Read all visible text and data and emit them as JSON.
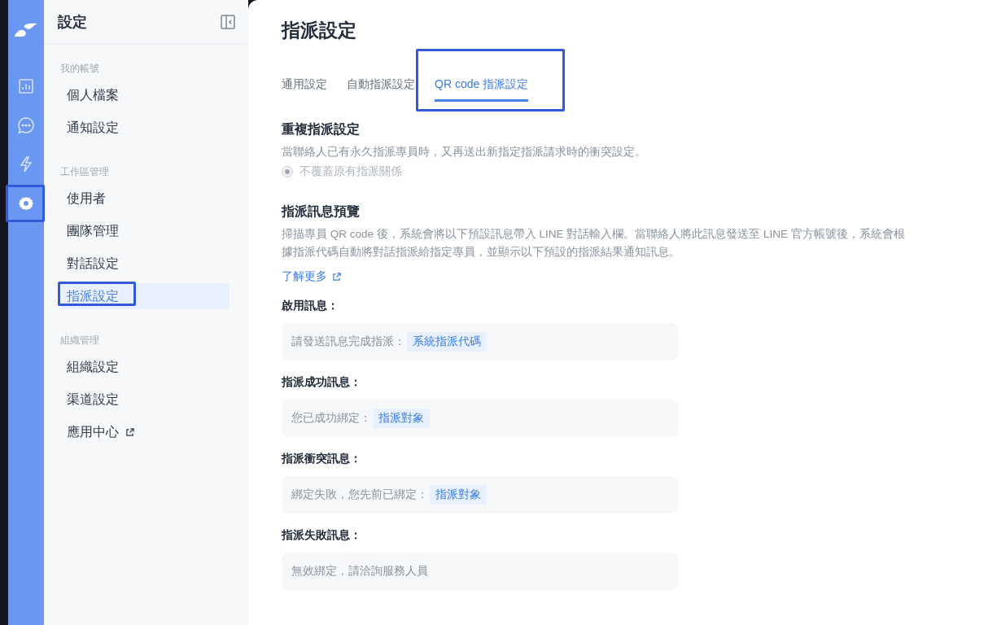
{
  "rail": {
    "items": [
      {
        "kind": "chart",
        "selected": false,
        "highlighted": false
      },
      {
        "kind": "chat",
        "selected": false,
        "highlighted": false
      },
      {
        "kind": "bolt",
        "selected": false,
        "highlighted": false
      },
      {
        "kind": "gear",
        "selected": true,
        "highlighted": true
      }
    ]
  },
  "sidebar": {
    "title": "設定",
    "sections": [
      {
        "label": "我的帳號",
        "items": [
          {
            "label": "個人檔案",
            "selected": false,
            "highlighted": false,
            "external": false
          },
          {
            "label": "通知設定",
            "selected": false,
            "highlighted": false,
            "external": false
          }
        ]
      },
      {
        "label": "工作區管理",
        "items": [
          {
            "label": "使用者",
            "selected": false,
            "highlighted": false,
            "external": false
          },
          {
            "label": "團隊管理",
            "selected": false,
            "highlighted": false,
            "external": false
          },
          {
            "label": "對話設定",
            "selected": false,
            "highlighted": false,
            "external": false
          },
          {
            "label": "指派設定",
            "selected": true,
            "highlighted": true,
            "external": false
          }
        ]
      },
      {
        "label": "組織管理",
        "items": [
          {
            "label": "組織設定",
            "selected": false,
            "highlighted": false,
            "external": false
          },
          {
            "label": "渠道設定",
            "selected": false,
            "highlighted": false,
            "external": false
          },
          {
            "label": "應用中心",
            "selected": false,
            "highlighted": false,
            "external": true
          }
        ]
      }
    ]
  },
  "main": {
    "title": "指派設定",
    "tabs": [
      {
        "label": "通用設定",
        "selected": false,
        "highlighted": false
      },
      {
        "label": "自動指派設定",
        "selected": false,
        "highlighted": false
      },
      {
        "label": "QR code 指派設定",
        "selected": true,
        "highlighted": true
      }
    ],
    "duplicate": {
      "heading": "重複指派設定",
      "description": "當聯絡人已有永久指派專員時，又再送出新指定指派請求時的衝突設定。",
      "option": {
        "label": "不覆蓋原有指派關係",
        "checked": true,
        "disabled": true
      }
    },
    "preview": {
      "heading": "指派訊息預覽",
      "description": "掃描專員 QR code 後，系統會將以下預設訊息帶入 LINE 對話輸入欄。當聯絡人將此訊息發送至 LINE 官方帳號後，系統會根據指派代碼自動將對話指派給指定專員，並顯示以下預設的指派結果通知訊息。",
      "link": "了解更多",
      "messages": [
        {
          "label": "啟用訊息：",
          "parts": [
            {
              "kind": "text",
              "text": "請發送訊息完成指派："
            },
            {
              "kind": "tag",
              "text": "系統指派代碼"
            }
          ]
        },
        {
          "label": "指派成功訊息：",
          "parts": [
            {
              "kind": "text",
              "text": "您已成功綁定："
            },
            {
              "kind": "tag",
              "text": "指派對象"
            }
          ]
        },
        {
          "label": "指派衝突訊息：",
          "parts": [
            {
              "kind": "text",
              "text": "綁定失敗，您先前已綁定："
            },
            {
              "kind": "tag",
              "text": "指派對象"
            }
          ]
        },
        {
          "label": "指派失敗訊息：",
          "parts": [
            {
              "kind": "text",
              "text": "無效綁定，請洽詢服務人員"
            }
          ]
        }
      ]
    }
  }
}
